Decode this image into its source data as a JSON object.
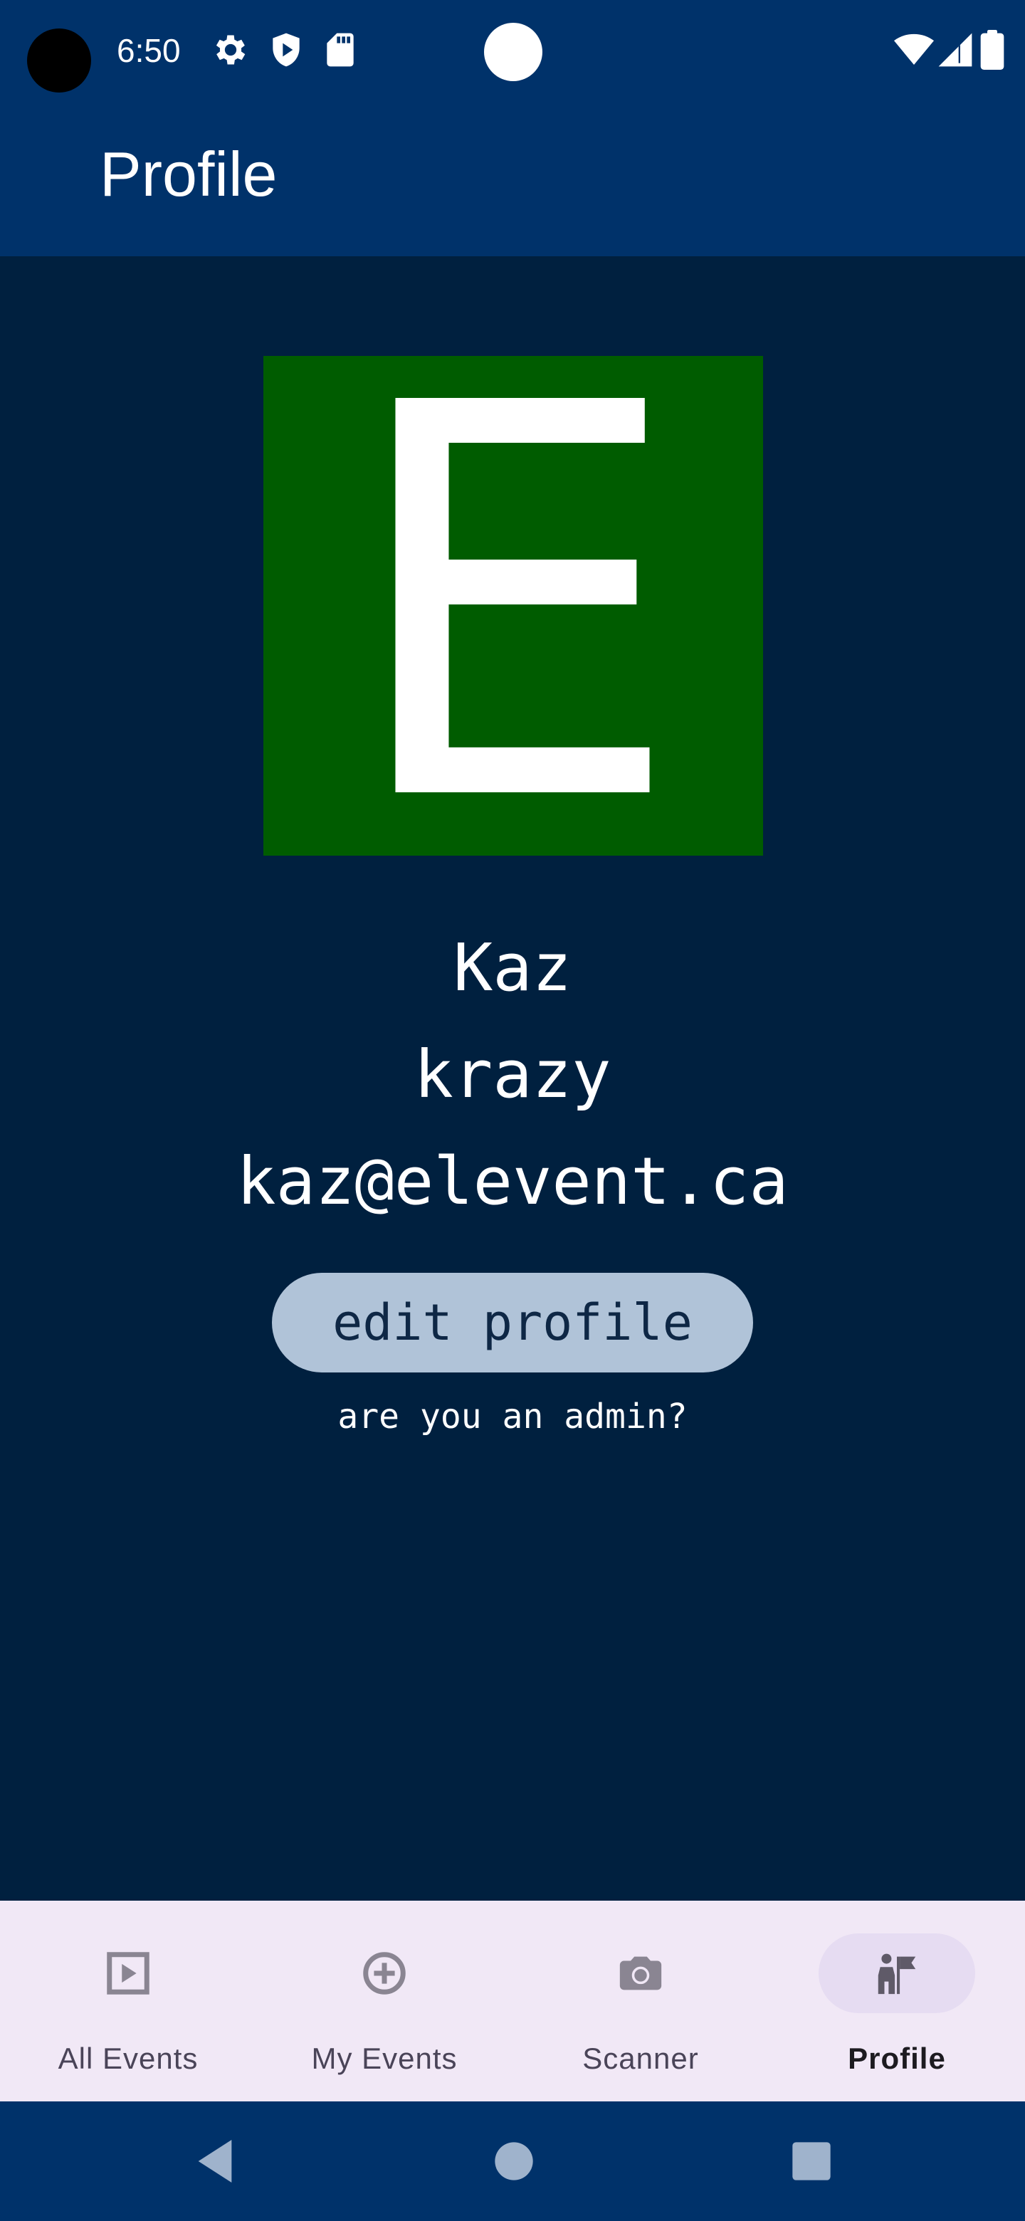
{
  "status_bar": {
    "time": "6:50",
    "icons": [
      "gear-icon",
      "shield-icon",
      "sd-card-icon",
      "wifi-icon",
      "cellular-signal-icon",
      "battery-icon"
    ]
  },
  "app_bar": {
    "title": "Profile"
  },
  "profile": {
    "avatar_letter": "E",
    "avatar_color": "#005c00",
    "name": "Kaz",
    "username": "krazy",
    "email": "kaz@elevent.ca",
    "edit_button_label": "edit profile",
    "admin_link_label": "are you an admin?"
  },
  "bottom_nav": {
    "items": [
      {
        "label": "All Events",
        "icon": "play-box-icon",
        "active": false
      },
      {
        "label": "My Events",
        "icon": "add-circle-icon",
        "active": false
      },
      {
        "label": "Scanner",
        "icon": "camera-icon",
        "active": false
      },
      {
        "label": "Profile",
        "icon": "profile-flag-icon",
        "active": true
      }
    ]
  },
  "system_nav": {
    "buttons": [
      "back-icon",
      "home-icon",
      "recents-icon"
    ]
  },
  "colors": {
    "bar_background": "#00326a",
    "page_background": "#00203f",
    "button_background": "#b0c3d8",
    "nav_background": "#f1e8f6"
  }
}
